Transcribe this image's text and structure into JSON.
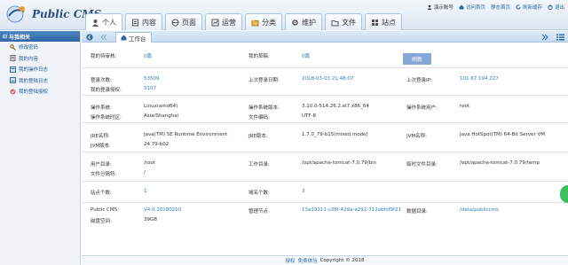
{
  "header": {
    "logo_text": "Public CMS",
    "nav_tabs": [
      {
        "label": "个人",
        "icon": "user-icon"
      },
      {
        "label": "内容",
        "icon": "document-icon"
      },
      {
        "label": "页面",
        "icon": "page-icon"
      },
      {
        "label": "运营",
        "icon": "operation-icon"
      },
      {
        "label": "分类",
        "icon": "category-icon"
      },
      {
        "label": "维护",
        "icon": "maintenance-icon"
      },
      {
        "label": "文件",
        "icon": "folder-icon"
      },
      {
        "label": "站点",
        "icon": "site-icon"
      }
    ],
    "links": {
      "user": "演示账号",
      "visit_home": "访问首页",
      "static_home": "静态首页",
      "refresh_cache": "刷新缓存",
      "logout": "退出"
    }
  },
  "sidebar": {
    "title": "与我相关",
    "items": [
      {
        "label": "修改密码",
        "icon": "key-icon"
      },
      {
        "label": "我的内容",
        "icon": "content-icon"
      },
      {
        "label": "我的操作日志",
        "icon": "log-icon"
      },
      {
        "label": "我的登陆日志",
        "icon": "login-log-icon"
      },
      {
        "label": "我的登陆授权",
        "icon": "auth-icon"
      }
    ]
  },
  "tabbar": {
    "work_tab": "工作台"
  },
  "content": {
    "refresh_label": "刷新",
    "rows": [
      {
        "c1": [
          "我的待审核:",
          "0篇"
        ],
        "c2": [
          "我的草稿:",
          "0篇"
        ]
      },
      {
        "c1": [
          "登录次数:",
          "53509"
        ],
        "c1b": [
          "我的登录授权:",
          "5107"
        ],
        "c2": [
          "上次登录日期:",
          "2018-03-03 21:48:07"
        ],
        "c3": [
          "上次登录IP:",
          "101.67.194.227"
        ]
      },
      {
        "c1": [
          "操作系统:",
          "Linux(amd64)"
        ],
        "c1b": [
          "操作系统时区:",
          "Asia/Shanghai"
        ],
        "c2": [
          "操作系统版本:",
          "3.10.0-514.26.2.el7.x86_64"
        ],
        "c2b": [
          "文件编码:",
          "UTF-8"
        ],
        "c3": [
          "操作系统用户:",
          "root"
        ]
      },
      {
        "c1": [
          "JRE名称:",
          "Java(TM) SE Runtime Environment"
        ],
        "c1b": [
          "JVM版本:",
          "24.79-b02"
        ],
        "c2": [
          "JRE版本:",
          "1.7.0_79-b15(mixed mode)"
        ],
        "c3": [
          "JVM名称:",
          "Java HotSpot(TM) 64-Bit Server VM"
        ]
      },
      {
        "c1": [
          "用户目录:",
          "/root"
        ],
        "c1b": [
          "文件分隔符:",
          "/"
        ],
        "c2": [
          "工作目录:",
          "/opt/apache-tomcat-7.0.79/bin"
        ],
        "c3": [
          "临时文件目录:",
          "/opt/apache-tomcat-7.0.79/temp"
        ]
      },
      {
        "c1": [
          "站点个数:",
          "1"
        ],
        "c2": [
          "域名个数:",
          "3"
        ]
      },
      {
        "c1": [
          "Public CMS:",
          "V4.0.20180210"
        ],
        "c1b": [
          "磁盘空间:",
          "39GB"
        ],
        "c2": [
          "管理节点:",
          "13a19211-c38f-429a-a292-712abfcf9f21"
        ],
        "c3": [
          "数据目录:",
          "/data/publiccms"
        ]
      }
    ]
  },
  "footer": {
    "link1": "授权",
    "link2": "免费体验",
    "copyright": "Copyright © 2018"
  }
}
